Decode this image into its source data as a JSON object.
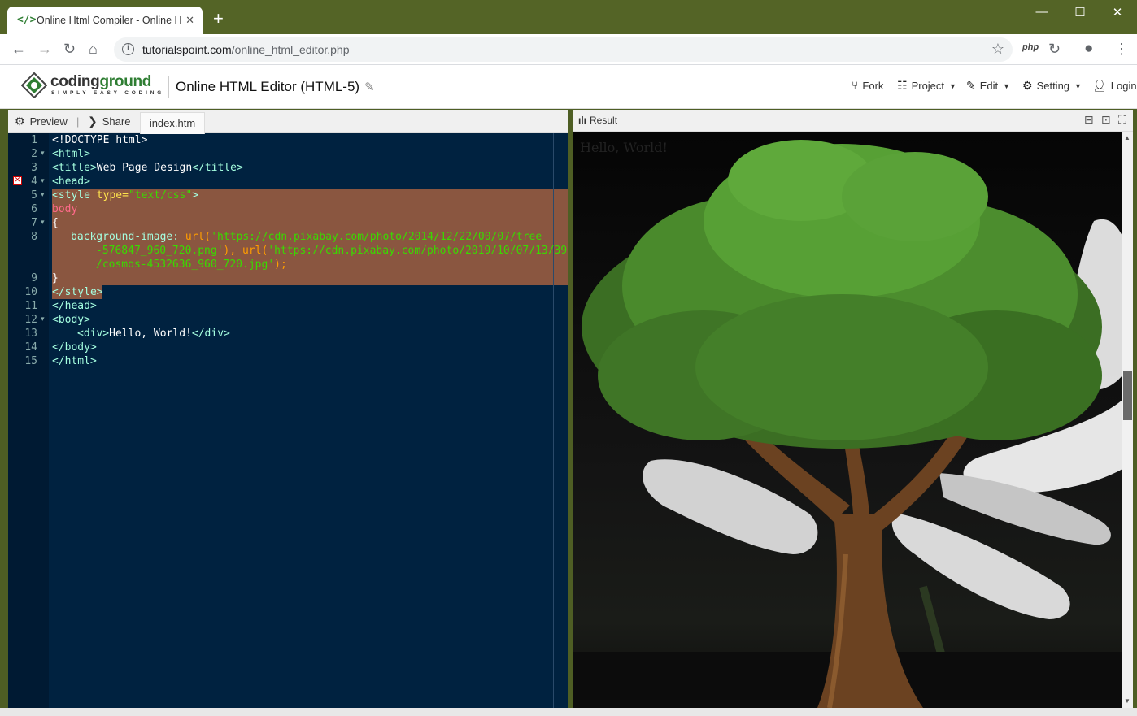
{
  "browser": {
    "tab_title": "Online Html Compiler - Online H",
    "tab_favicon": "</>",
    "url_host": "tutorialspoint.com",
    "url_path": "/online_html_editor.php",
    "extension_label": "php"
  },
  "site": {
    "brand_left": "coding",
    "brand_right": "ground",
    "tagline": "SIMPLY EASY CODING",
    "page_title": "Online HTML Editor (HTML-5)",
    "menu": {
      "fork": "Fork",
      "project": "Project",
      "edit": "Edit",
      "setting": "Setting",
      "login": "Login"
    }
  },
  "editor": {
    "preview_label": "Preview",
    "share_label": "Share",
    "file_tab": "index.htm",
    "line_numbers": [
      "1",
      "2",
      "3",
      "4",
      "5",
      "6",
      "7",
      "8",
      "",
      "",
      "9",
      "10",
      "11",
      "12",
      "13",
      "14",
      "15"
    ],
    "code": {
      "l1": "<!DOCTYPE html>",
      "l2": "<html>",
      "l3_open": "<title>",
      "l3_text": "Web Page Design",
      "l3_close": "</title>",
      "l4": "<head>",
      "l5_tag": "<style ",
      "l5_attr": "type=",
      "l5_val": "\"text/css\"",
      "l5_end": ">",
      "l6": "body",
      "l7": "{",
      "l8_prop": "background-image:",
      "l8_fn1": " url(",
      "l8_url1a": "'https://cdn.pixabay.com/photo/2014/12/22/00/07/tree",
      "l8_url1b": "-576847_960_720.png'",
      "l8_mid": "), ",
      "l8_fn2": "url(",
      "l8_url2a": "'https://cdn.pixabay.com/photo/2019/10/07/13/39",
      "l8_url2b": "/cosmos-4532636_960_720.jpg'",
      "l8_end": ");",
      "l9": "}",
      "l10": "</style>",
      "l11": "</head>",
      "l12": "<body>",
      "l13_open": "<div>",
      "l13_text": "Hello, World!",
      "l13_close": "</div>",
      "l14": "</body>",
      "l15": "</html>"
    }
  },
  "result": {
    "label": "Result",
    "hello_text": "Hello, World!"
  },
  "colors": {
    "browser_frame": "#546426",
    "editor_bg": "#002240",
    "selection": "#8a5640",
    "brand_green": "#2e7d32"
  }
}
